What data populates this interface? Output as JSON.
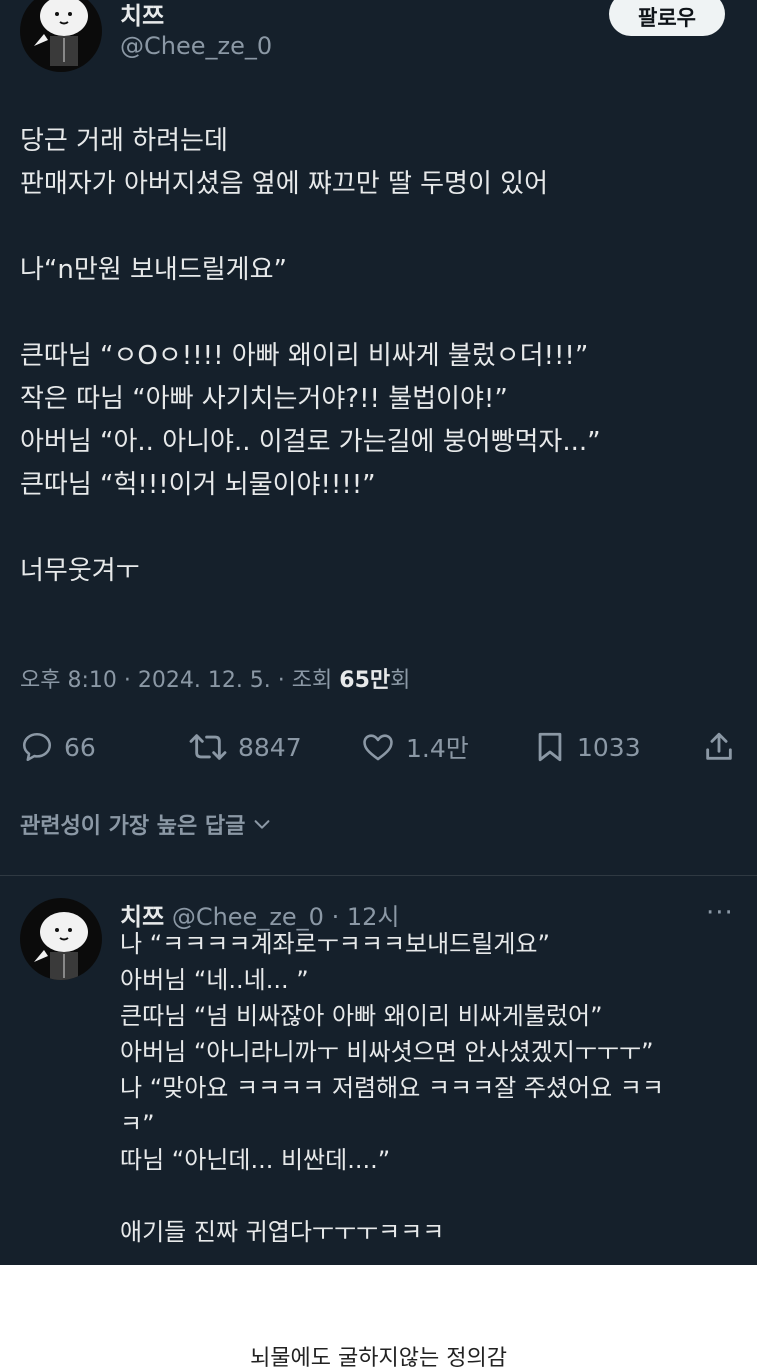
{
  "post": {
    "author_name": "치쯔",
    "author_handle": "@Chee_ze_0",
    "follow_label": "팔로우",
    "body_lines": [
      "당근 거래 하려는데",
      "판매자가 아버지셨음 옆에 쨔끄만 딸 두명이 있어",
      "",
      "나“n만원 보내드릴게요”",
      "",
      "큰따님 “ㅇOㅇ!!!! 아빠 왜이리 비싸게 불렀ㅇ더!!!”",
      "작은 따님 “아빠 사기치는거야?!! 불법이야!”",
      "아버님 “아.. 아니야.. 이걸로 가는길에 붕어빵먹자...”",
      "큰따님 “헉!!!이거 뇌물이야!!!!”",
      "",
      "너무웃겨ㅜ"
    ],
    "meta_time": "오후 8:10 · 2024. 12. 5. · 조회 ",
    "meta_views": "65만",
    "meta_views_suffix": "회"
  },
  "actions": {
    "replies": "66",
    "reposts": "8847",
    "likes": "1.4만",
    "bookmarks": "1033"
  },
  "relevant_label": "관련성이 가장 높은 답글",
  "reply": {
    "author_name": "치쯔",
    "author_handle_time": "@Chee_ze_0 · 12시",
    "more_label": "···",
    "body_lines": [
      "나 “ㅋㅋㅋㅋ계좌로ㅜㅋㅋㅋ보내드릴게요”",
      "아버님 “네..네... ”",
      "큰따님 “넘 비싸잖아 아빠 왜이리 비싸게불렀어”",
      "아버님 “아니라니까ㅜ 비싸셧으면 안사셨겠지ㅜㅜㅜ”",
      "나 “맞아요 ㅋㅋㅋㅋ 저렴해요 ㅋㅋㅋ잘 주셨어요 ㅋㅋ",
      "ㅋ”",
      "따님 “아닌데... 비싼데....”",
      "",
      "애기들 진짜 귀엽다ㅜㅜㅜㅋㅋㅋ"
    ]
  },
  "caption": "뇌물에도 굴하지않는 정의감",
  "colors": {
    "background": "#15202b",
    "text": "#e7e9ea",
    "muted": "#8b98a5",
    "follow_bg": "#eff3f4"
  }
}
